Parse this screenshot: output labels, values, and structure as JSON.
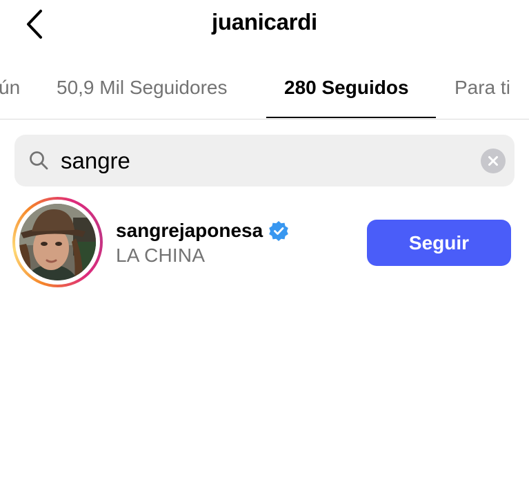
{
  "header": {
    "title": "juanicardi",
    "back_icon": "chevron-left-icon"
  },
  "tabs": [
    {
      "label": "ún",
      "active": false
    },
    {
      "label": "50,9 Mil Seguidores",
      "active": false
    },
    {
      "label": "280 Seguidos",
      "active": true
    },
    {
      "label": "Para ti",
      "active": false
    }
  ],
  "search": {
    "value": "sangre",
    "icon": "search-icon",
    "clear_icon": "clear-icon"
  },
  "results": [
    {
      "username": "sangrejaponesa",
      "verified": true,
      "full_name": "LA CHINA",
      "follow_label": "Seguir"
    }
  ],
  "colors": {
    "accent": "#4a5df9",
    "verified": "#3897f0",
    "secondary_text": "#737373",
    "search_bg": "#efefef"
  }
}
